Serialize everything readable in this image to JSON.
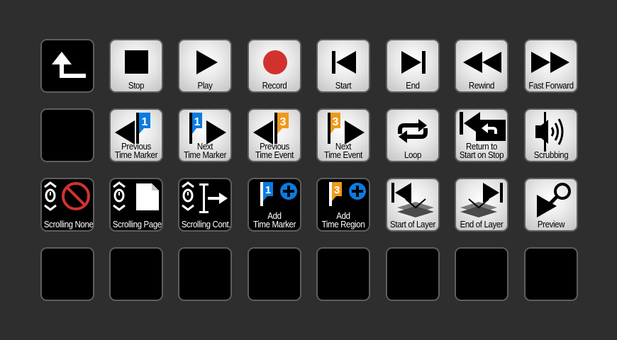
{
  "colors": {
    "background": "#2e2e2e",
    "record_red": "#d2322d",
    "marker_blue": "#0a7be0",
    "event_orange": "#ee9a1a"
  },
  "row1": [
    {
      "icon": "back-arrow-icon",
      "label": ""
    },
    {
      "icon": "stop-icon",
      "label": "Stop"
    },
    {
      "icon": "play-icon",
      "label": "Play"
    },
    {
      "icon": "record-icon",
      "label": "Record"
    },
    {
      "icon": "skip-to-start-icon",
      "label": "Start"
    },
    {
      "icon": "skip-to-end-icon",
      "label": "End"
    },
    {
      "icon": "rewind-icon",
      "label": "Rewind"
    },
    {
      "icon": "fast-forward-icon",
      "label": "Fast Forward"
    }
  ],
  "row2": [
    {
      "icon": "",
      "l1": "",
      "l2": ""
    },
    {
      "icon": "previous-time-marker-icon",
      "marker_number": "1",
      "l1": "Previous",
      "l2": "Time Marker"
    },
    {
      "icon": "next-time-marker-icon",
      "marker_number": "1",
      "l1": "Next",
      "l2": "Time Marker"
    },
    {
      "icon": "previous-time-event-icon",
      "marker_number": "3",
      "l1": "Previous",
      "l2": "Time Event"
    },
    {
      "icon": "next-time-event-icon",
      "marker_number": "3",
      "l1": "Next",
      "l2": "Time Event"
    },
    {
      "icon": "loop-icon",
      "l1": "",
      "l2": "Loop"
    },
    {
      "icon": "return-to-start-icon",
      "l1": "Return to",
      "l2": "Start on Stop"
    },
    {
      "icon": "scrubbing-icon",
      "l1": "",
      "l2": "Scrubbing"
    }
  ],
  "row3": [
    {
      "icon": "scrolling-none-icon",
      "l1": "",
      "l2": "Scrolling None"
    },
    {
      "icon": "scrolling-page-icon",
      "l1": "",
      "l2": "Scrolling Page"
    },
    {
      "icon": "scrolling-continuous-icon",
      "l1": "",
      "l2": "Scrolling Cont."
    },
    {
      "icon": "add-time-marker-icon",
      "marker_number": "1",
      "l1": "Add",
      "l2": "Time Marker"
    },
    {
      "icon": "add-time-region-icon",
      "marker_number": "3",
      "l1": "Add",
      "l2": "Time Region"
    },
    {
      "icon": "start-of-layer-icon",
      "l1": "",
      "l2": "Start of Layer"
    },
    {
      "icon": "end-of-layer-icon",
      "l1": "",
      "l2": "End of Layer"
    },
    {
      "icon": "preview-icon",
      "l1": "",
      "l2": "Preview"
    }
  ]
}
